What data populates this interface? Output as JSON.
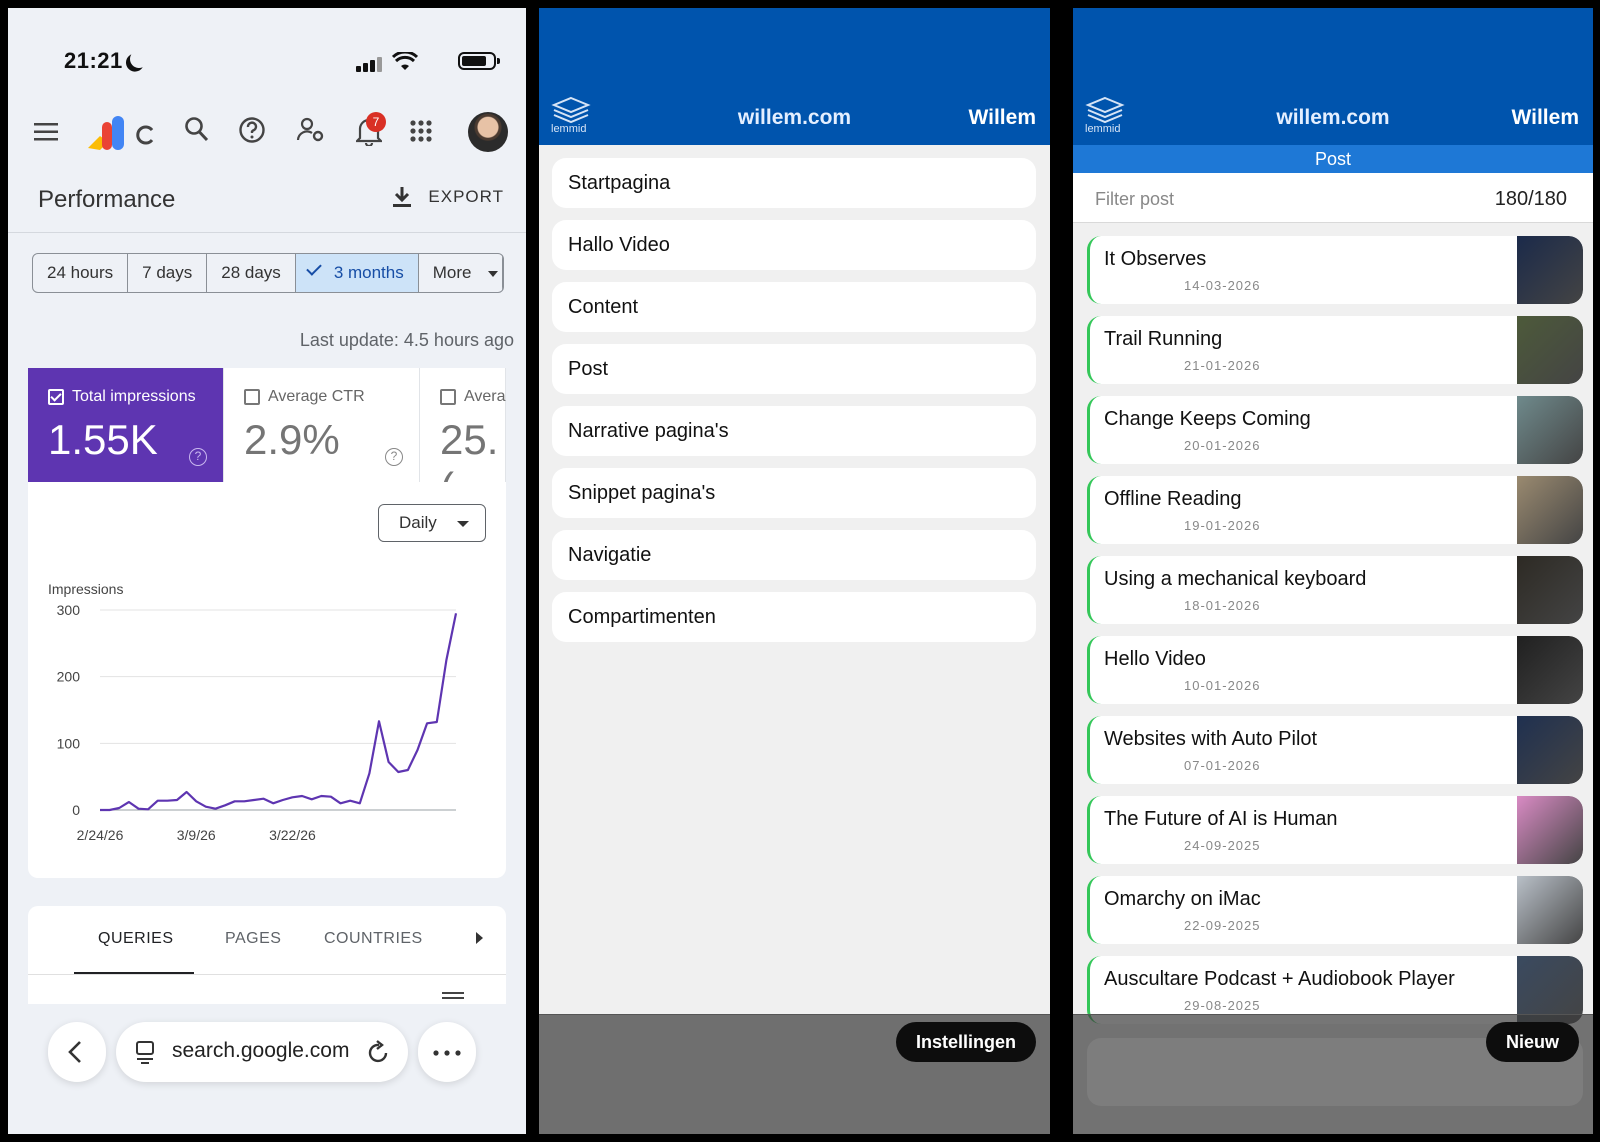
{
  "console": {
    "status": {
      "time": "21:21"
    },
    "notifications_count": "7",
    "page_title": "Performance",
    "export_label": "EXPORT",
    "ranges": [
      "24 hours",
      "7 days",
      "28 days",
      "3 months",
      "More"
    ],
    "selected_range": "3 months",
    "last_update": "Last update: 4.5 hours ago",
    "metrics": [
      {
        "label": "Total impressions",
        "value": "1.55K",
        "checked": true
      },
      {
        "label": "Average CTR",
        "value": "2.9%",
        "checked": false
      },
      {
        "label": "Avera",
        "value": "25.(",
        "checked": false
      }
    ],
    "granularity": "Daily",
    "tabs": [
      "QUERIES",
      "PAGES",
      "COUNTRIES"
    ],
    "active_tab": "QUERIES",
    "url": "search.google.com",
    "accent": "#5e35b1"
  },
  "chart_data": {
    "type": "line",
    "ylabel": "Impressions",
    "ylim": [
      0,
      300
    ],
    "yticks": [
      "300",
      "200",
      "100",
      "0"
    ],
    "xticks": [
      "2/24/26",
      "3/9/26",
      "3/22/26"
    ],
    "series": [
      {
        "values": [
          0,
          0,
          3,
          12,
          2,
          1,
          14,
          14,
          15,
          27,
          13,
          5,
          2,
          7,
          13,
          13,
          15,
          17,
          10,
          15,
          19,
          21,
          16,
          21,
          20,
          10,
          14,
          10,
          55,
          133,
          72,
          57,
          60,
          90,
          130,
          132,
          225,
          295
        ]
      }
    ],
    "color": "#5e35b1",
    "grid": true
  },
  "menu_app": {
    "logo_text": "lemmid",
    "site": "willem.com",
    "user": "Willem",
    "items": [
      "Startpagina",
      "Hallo Video",
      "Content",
      "Post",
      "Narrative pagina's",
      "Snippet pagina's",
      "Navigatie",
      "Compartimenten"
    ],
    "settings_button": "Instellingen",
    "header_color": "#0054ad"
  },
  "post_app": {
    "logo_text": "lemmid",
    "site": "willem.com",
    "user": "Willem",
    "section": "Post",
    "filter_placeholder": "Filter post",
    "count": "180/180",
    "new_button": "Nieuw",
    "posts": [
      {
        "title": "It Observes",
        "date": "14-03-2026",
        "thumb": "#1b2a4a"
      },
      {
        "title": "Trail Running",
        "date": "21-01-2026",
        "thumb": "#4d5a3a"
      },
      {
        "title": "Change Keeps Coming",
        "date": "20-01-2026",
        "thumb": "#6f8a8c"
      },
      {
        "title": "Offline Reading",
        "date": "19-01-2026",
        "thumb": "#9a8a70"
      },
      {
        "title": "Using a mechanical keyboard",
        "date": "18-01-2026",
        "thumb": "#2d2a24"
      },
      {
        "title": "Hello Video",
        "date": "10-01-2026",
        "thumb": "#202020"
      },
      {
        "title": "Websites with Auto Pilot",
        "date": "07-01-2026",
        "thumb": "#1f3050"
      },
      {
        "title": "The Future of AI is Human",
        "date": "24-09-2025",
        "thumb": "#d98bc4"
      },
      {
        "title": "Omarchy on iMac",
        "date": "22-09-2025",
        "thumb": "#b9c0c8"
      },
      {
        "title": "Auscultare Podcast + Audiobook Player",
        "date": "29-08-2025",
        "thumb": "#3a4a60"
      }
    ]
  }
}
